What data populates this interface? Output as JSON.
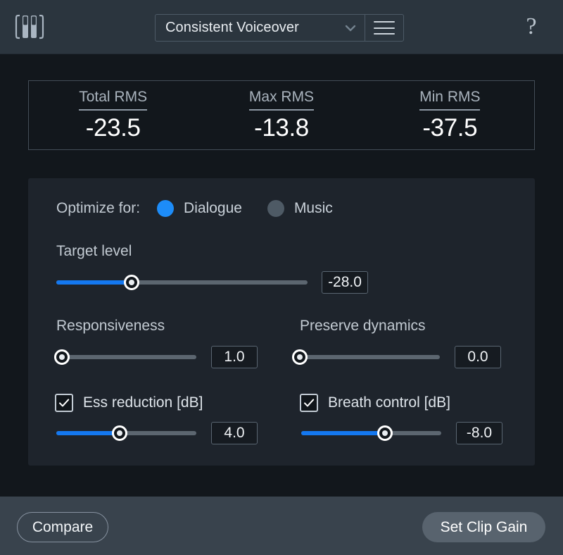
{
  "header": {
    "logo_icon": "izotope-rx-logo-icon",
    "preset_name": "Consistent Voiceover",
    "dropdown_icon": "chevron-down-icon",
    "menu_icon": "hamburger-menu-icon",
    "help_icon": "question-mark-icon",
    "help_label": "?"
  },
  "stats": [
    {
      "label": "Total RMS",
      "value": "-23.5"
    },
    {
      "label": "Max RMS",
      "value": "-13.8"
    },
    {
      "label": "Min RMS",
      "value": "-37.5"
    }
  ],
  "optimize": {
    "label": "Optimize for:",
    "options": [
      {
        "label": "Dialogue",
        "selected": true
      },
      {
        "label": "Music",
        "selected": false
      }
    ]
  },
  "controls": {
    "target_level": {
      "label": "Target level",
      "value": "-28.0",
      "percent": 30
    },
    "responsiveness": {
      "label": "Responsiveness",
      "value": "1.0",
      "percent": 4
    },
    "preserve_dynamics": {
      "label": "Preserve dynamics",
      "value": "0.0",
      "percent": 0
    },
    "ess_reduction": {
      "label": "Ess reduction [dB]",
      "value": "4.0",
      "percent": 45,
      "checked": true
    },
    "breath_control": {
      "label": "Breath control [dB]",
      "value": "-8.0",
      "percent": 60,
      "checked": true
    }
  },
  "footer": {
    "compare_label": "Compare",
    "set_clip_gain_label": "Set Clip Gain"
  },
  "colors": {
    "accent_blue": "#1478f0",
    "radio_on": "#1d8cf8",
    "radio_off": "#4e5a65",
    "header_bg": "#2b353e",
    "page_bg": "#12171c",
    "panel_bg": "#1e242c",
    "footer_bg": "#39434d",
    "button_fill": "#58636e"
  }
}
